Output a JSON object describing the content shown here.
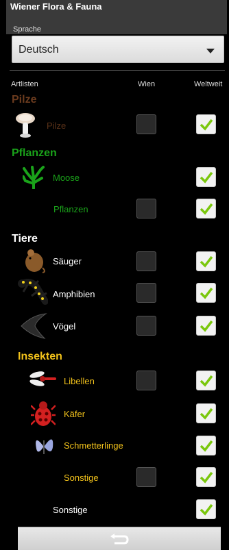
{
  "app": {
    "title": "Wiener Flora & Fauna"
  },
  "language": {
    "label": "Sprache",
    "selected": "Deutsch"
  },
  "columns": {
    "list": "Artlisten",
    "local": "Wien",
    "global": "Weltweit"
  },
  "sections": {
    "pilze": {
      "title": "Pilze",
      "color": "#6b3b1e"
    },
    "pflanzen": {
      "title": "Pflanzen",
      "color": "#1aa31a"
    },
    "tiere": {
      "title": "Tiere",
      "color": "#ffffff"
    },
    "insekten": {
      "title": "Insekten",
      "color": "#f2c21b"
    }
  },
  "rows": [
    {
      "label": "Pilze",
      "icon": "mushroom-icon",
      "wien": false,
      "weltweit": true,
      "color": "#5a3218"
    },
    {
      "label": "Moose",
      "icon": "moss-icon",
      "wien": null,
      "weltweit": true,
      "color": "#1aa31a"
    },
    {
      "label": "Pflanzen",
      "icon": null,
      "wien": false,
      "weltweit": true,
      "color": "#1aa31a"
    },
    {
      "label": "Säuger",
      "icon": "mouse-icon",
      "wien": false,
      "weltweit": true,
      "color": "#ffffff"
    },
    {
      "label": "Amphibien",
      "icon": "salamander-icon",
      "wien": false,
      "weltweit": true,
      "color": "#ffffff"
    },
    {
      "label": "Vögel",
      "icon": "bird-icon",
      "wien": false,
      "weltweit": true,
      "color": "#ffffff"
    },
    {
      "label": "Libellen",
      "icon": "dragonfly-icon",
      "wien": false,
      "weltweit": true,
      "color": "#f2c21b"
    },
    {
      "label": "Käfer",
      "icon": "beetle-icon",
      "wien": null,
      "weltweit": true,
      "color": "#f2c21b"
    },
    {
      "label": "Schmetterlinge",
      "icon": "butterfly-icon",
      "wien": null,
      "weltweit": true,
      "color": "#f2c21b"
    },
    {
      "label": "Sonstige",
      "icon": null,
      "wien": false,
      "weltweit": true,
      "color": "#f2c21b"
    },
    {
      "label": "Sonstige",
      "icon": null,
      "wien": null,
      "weltweit": true,
      "color": "#ffffff"
    }
  ],
  "bottom_button": {
    "icon": "back-icon"
  }
}
